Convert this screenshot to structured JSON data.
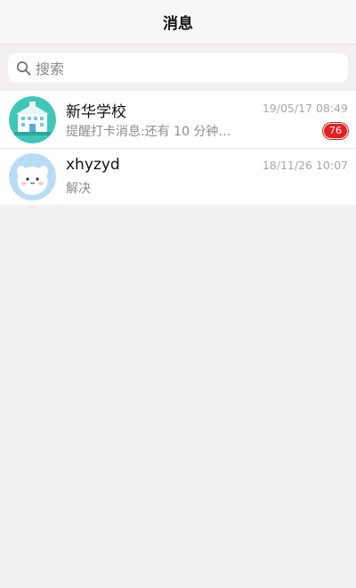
{
  "header": {
    "title": "消息"
  },
  "search": {
    "placeholder": "搜索",
    "icon": "search-icon"
  },
  "conversations": [
    {
      "name": "新华学校",
      "preview": "提醒打卡消息:还有 10 分钟…",
      "time": "19/05/17 08:49",
      "unread": "76",
      "avatar": "school-building-avatar"
    },
    {
      "name": "xhyzyd",
      "preview": "解决",
      "time": "18/11/26 10:07",
      "avatar": "cartoon-face-avatar"
    }
  ],
  "colors": {
    "badge": "#e61f1f",
    "background": "#f2f0f1",
    "avatar_teal": "#3fc7b8",
    "avatar_blue": "#b9dcf5"
  }
}
